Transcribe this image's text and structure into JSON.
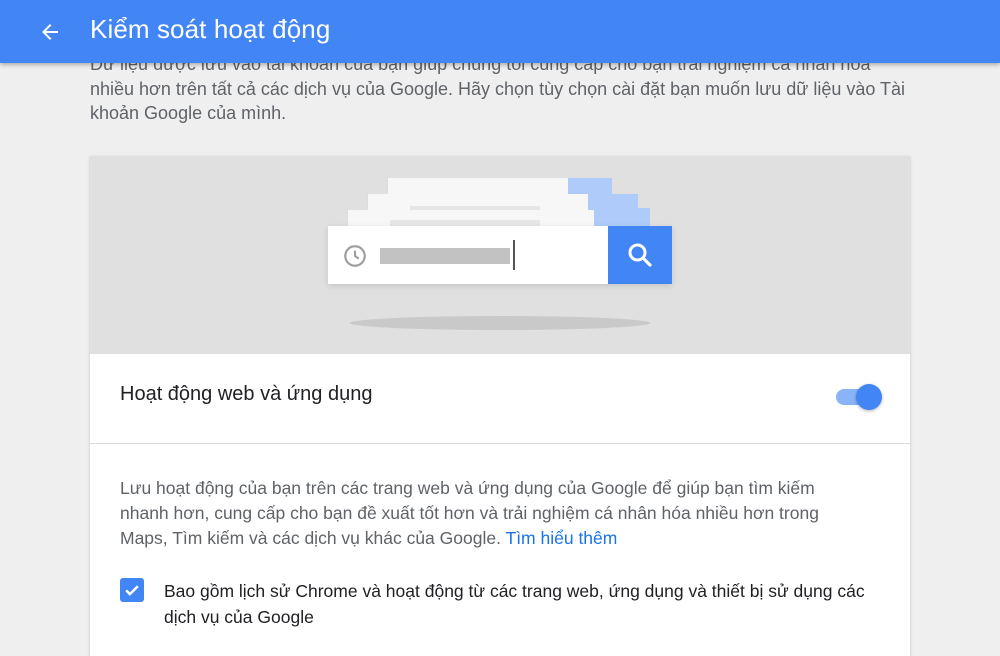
{
  "appbar": {
    "title": "Kiểm soát hoạt động",
    "back_icon": "arrow-back-icon",
    "color": "#4285f4"
  },
  "intro": {
    "text": "Dữ liệu được lưu vào tài khoản của bạn giúp chúng tôi cung cấp cho bạn trải nghiệm cá nhân hóa nhiều hơn trên tất cả các dịch vụ của Google. Hãy chọn tùy chọn cài đặt bạn muốn lưu dữ liệu vào Tài khoản Google của mình."
  },
  "illustration": {
    "search_icon": "search-icon",
    "history_icon": "history-clock-icon"
  },
  "activity": {
    "label": "Hoạt động web và ứng dụng",
    "enabled": true
  },
  "description": {
    "text": "Lưu hoạt động của bạn trên các trang web và ứng dụng của Google để giúp bạn tìm kiếm nhanh hơn, cung cấp cho bạn đề xuất tốt hơn và trải nghiệm cá nhân hóa nhiều hơn trong Maps, Tìm kiếm và các dịch vụ khác của Google.",
    "learn_more": "Tìm hiểu thêm"
  },
  "chrome_history": {
    "checked": true,
    "label": "Bao gồm lịch sử Chrome và hoạt động từ các trang web, ứng dụng và thiết bị sử dụng các dịch vụ của Google"
  }
}
